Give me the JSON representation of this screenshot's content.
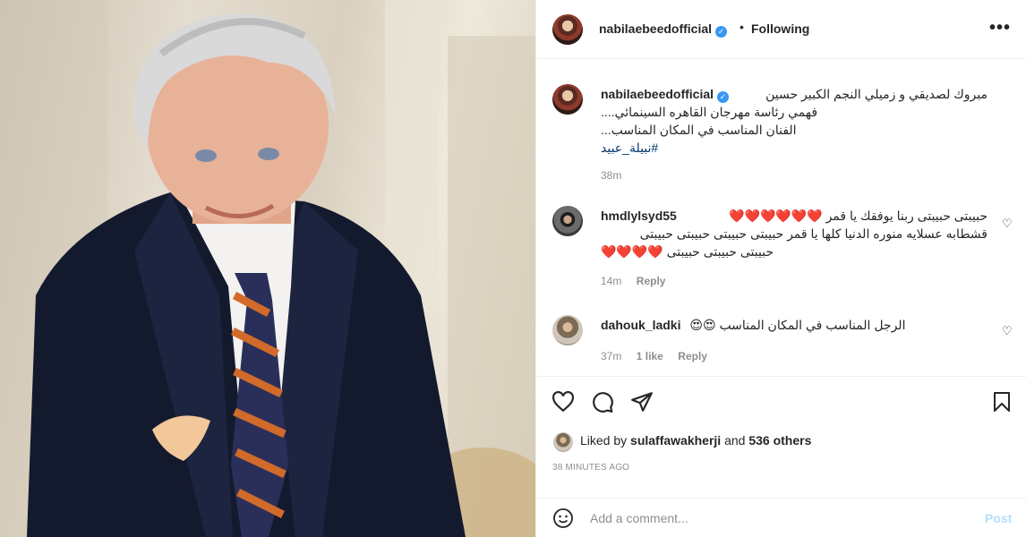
{
  "post": {
    "username": "nabilaebeedofficial",
    "verified_icon": "verified-badge-icon",
    "follow_status": "Following",
    "caption_lines": [
      "مبروك لصديقي و زميلي النجم الكبير حسين",
      "فهمي رئاسة مهرجان القاهره السينمائي....",
      "الفنان المناسب في المكان المناسب...",
      "#نبيلة_عبيد"
    ],
    "caption_time": "38m"
  },
  "comments": [
    {
      "username": "hmdlylsyd55",
      "lines": [
        "حبيبتى حبيبتى ربنا يوفقك يا قمر ❤️❤️❤️❤️❤️❤️",
        "قشطابه عسلايه منوره الدنيا كلها يا قمر حبيبتى حبيبتى حبيبتى حبيبتى",
        "حبيبتى حبيبتى حبيبتى ❤️❤️❤️❤️"
      ],
      "time": "14m",
      "reply": "Reply"
    },
    {
      "username": "dahouk_ladki",
      "lines": [
        "الرجل المناسب في المكان المناسب 😍😍"
      ],
      "time": "37m",
      "likes": "1 like",
      "reply": "Reply"
    }
  ],
  "likes": {
    "prefix": "Liked by",
    "user": "sulaffawakherji",
    "middle": "and",
    "count": "536 others"
  },
  "timestamp": "38 MINUTES AGO",
  "comment_input": {
    "placeholder": "Add a comment...",
    "post_label": "Post"
  },
  "colors": {
    "verified": "#3897f0",
    "like_red": "#ed4956",
    "post_disabled": "#b2dffc",
    "hashtag": "#00376b"
  }
}
